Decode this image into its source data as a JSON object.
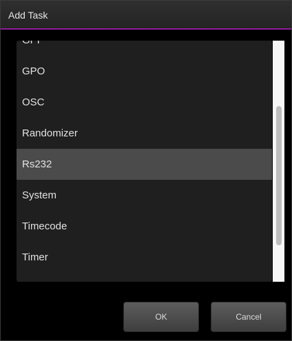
{
  "dialog": {
    "title": "Add Task",
    "accent_color": "#8e1e9c"
  },
  "task_list": {
    "items": [
      {
        "label": "GPI"
      },
      {
        "label": "GPO"
      },
      {
        "label": "OSC"
      },
      {
        "label": "Randomizer"
      },
      {
        "label": "Rs232"
      },
      {
        "label": "System"
      },
      {
        "label": "Timecode"
      },
      {
        "label": "Timer"
      }
    ],
    "selected": "Rs232"
  },
  "buttons": {
    "ok_label": "OK",
    "cancel_label": "Cancel"
  }
}
